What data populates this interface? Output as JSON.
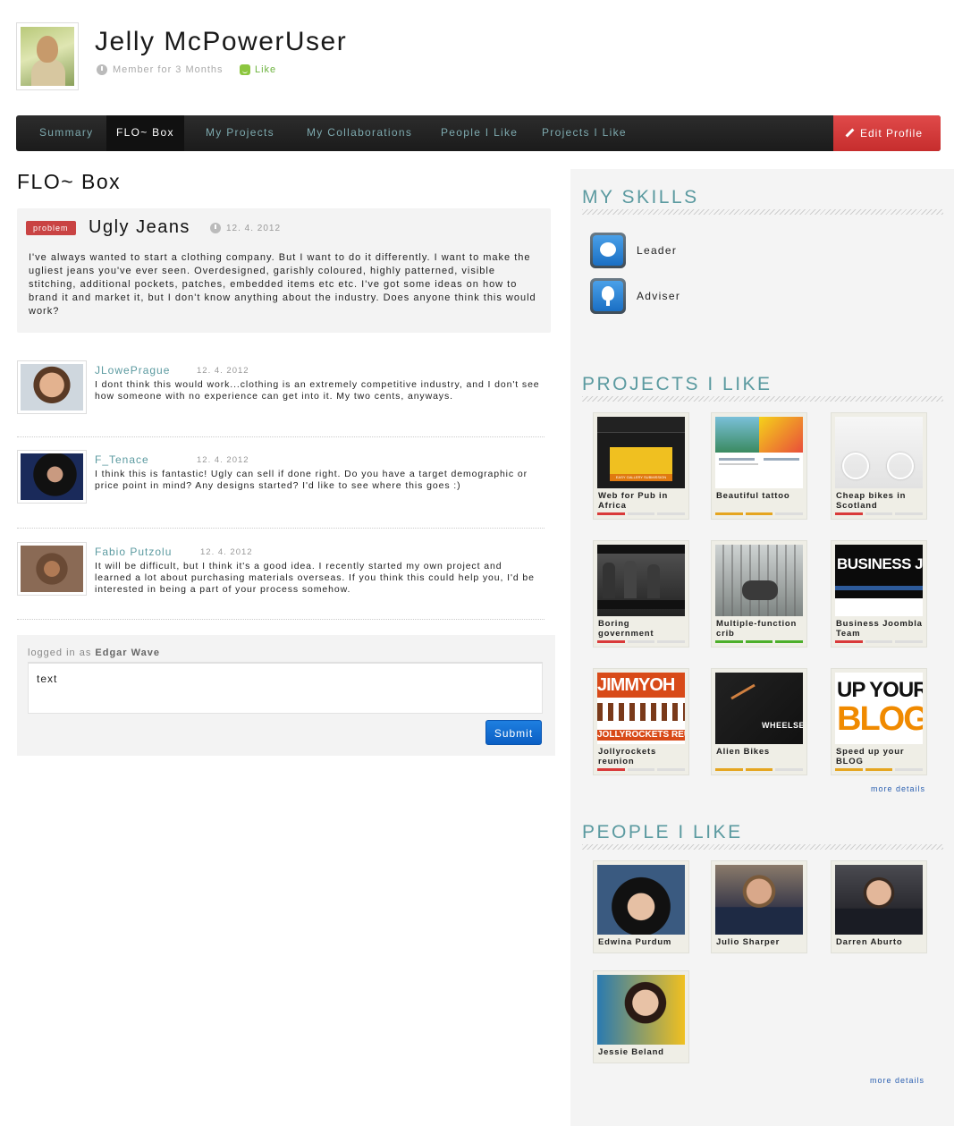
{
  "user": {
    "name": "Jelly McPowerUser",
    "member_since": "Member for 3 Months",
    "like_label": "Like"
  },
  "nav": {
    "tabs": [
      {
        "label": "Summary"
      },
      {
        "label": "FLO~ Box"
      },
      {
        "label": "My Projects"
      },
      {
        "label": "My Collaborations"
      },
      {
        "label": "People I Like"
      },
      {
        "label": "Projects I Like"
      }
    ],
    "active_tab": "FLO~ Box",
    "edit_label": "Edit Profile"
  },
  "main": {
    "title": "FLO~ Box",
    "post": {
      "badge": "problem",
      "title": "Ugly Jeans",
      "date": "12. 4. 2012",
      "body": "I've always wanted to start a clothing company. But I want to do it differently. I want to make the ugliest jeans you've ever seen. Overdesigned, garishly coloured, highly pat­terned, visible stitching, additional pockets, patches, embedded items etc etc. I've got some ideas on how to brand it and market it, but I don't know anything about the indus­try. Does anyone think this would work?"
    },
    "comments": [
      {
        "name": "JLowePrague",
        "date": "12. 4. 2012",
        "text": "I dont think this would work...clothing is an extremely competitive industry, and I don't see how someone with no experience can get into it. My two cents, anyways."
      },
      {
        "name": "F_Tenace",
        "date": "12. 4. 2012",
        "text": "I think this is fantastic! Ugly can sell if done right. Do you have a target demo­graphic or price point in mind? Any designs started? I'd like to see where this goes :)"
      },
      {
        "name": "Fabio Putzolu",
        "date": "12. 4. 2012",
        "text": "It will be difficult, but I think it's a good idea. I recently started my own project and learned a lot about purchasing materials overseas. If you think this could help you, I'd be interested in being a part of your process somehow."
      }
    ],
    "reply": {
      "logged_in_prefix": "logged in as",
      "logged_in_user": "Edgar Wave",
      "value": "text",
      "submit_label": "Submit"
    }
  },
  "sidebar": {
    "skills_title": "MY SKILLS",
    "skills": [
      {
        "label": "Leader",
        "icon": "chat-bubble-icon"
      },
      {
        "label": "Adviser",
        "icon": "lightbulb-icon"
      }
    ],
    "projects_title": "PROJECTS I LIKE",
    "projects": [
      {
        "title": "Web for Pub in Africa",
        "bar_color": "#d93a3a",
        "bar_fill": 0.33
      },
      {
        "title": "Beautiful tattoo",
        "bar_color": "#e5a520",
        "bar_fill": 0.66
      },
      {
        "title": "Cheap bikes in Scotland",
        "bar_color": "#d93a3a",
        "bar_fill": 0.33
      },
      {
        "title": "Boring government",
        "bar_color": "#d93a3a",
        "bar_fill": 0.33
      },
      {
        "title": "Multiple-function crib",
        "bar_color": "#4caf2a",
        "bar_fill": 1.0
      },
      {
        "title": "Business Joombla Team",
        "bar_color": "#d93a3a",
        "bar_fill": 0.33
      },
      {
        "title": "Jollyrockets reunion",
        "bar_color": "#d93a3a",
        "bar_fill": 0.33
      },
      {
        "title": "Alien Bikes",
        "bar_color": "#e5a520",
        "bar_fill": 0.66
      },
      {
        "title": "Speed up your BLOG",
        "bar_color": "#e5a520",
        "bar_fill": 0.66
      }
    ],
    "projects_more": "more details",
    "people_title": "PEOPLE I LIKE",
    "people": [
      {
        "name": "Edwina Purdum"
      },
      {
        "name": "Julio Sharper"
      },
      {
        "name": "Darren Aburto"
      },
      {
        "name": "Jessie Beland"
      }
    ],
    "people_more": "more details",
    "thumb_text": {
      "p0": "EASY GALLERY SUBMISSION",
      "p5": "BUSINESS JO",
      "p6a": "JIMMYOH",
      "p6b": "JOLLYROCKETS REUN",
      "p7": "WHEELSETS",
      "p8a": "UP YOUR",
      "p8b": "BLOG"
    }
  }
}
